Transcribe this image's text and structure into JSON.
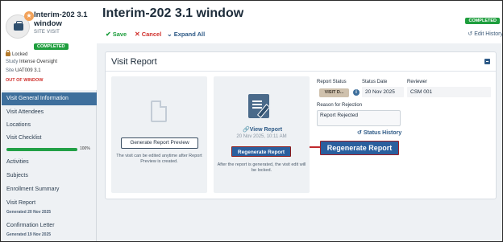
{
  "visit": {
    "title": "Interim-202 3.1 window",
    "type": "SITE VISIT",
    "status": "COMPLETED",
    "locked_label": "Locked",
    "study_label": "Study",
    "study": "Intense Oversight",
    "site_label": "Site",
    "site": "UAT009 3.1",
    "window_flag": "OUT OF WINDOW"
  },
  "nav": {
    "items": [
      {
        "label": "Visit General Information",
        "active": true
      },
      {
        "label": "Visit Attendees"
      },
      {
        "label": "Locations"
      },
      {
        "label": "Visit Checklist",
        "progress": 1.0,
        "progress_text": "100%"
      },
      {
        "label": "Activities"
      },
      {
        "label": "Subjects"
      },
      {
        "label": "Enrollment Summary"
      },
      {
        "label": "Visit Report",
        "sub": "Generated 20 Nov 2025"
      },
      {
        "label": "Confirmation Letter",
        "sub": "Generated 19 Nov 2025"
      }
    ]
  },
  "header": {
    "title": "Interim-202 3.1 window",
    "status": "COMPLETED"
  },
  "toolbar": {
    "save_label": "Save",
    "cancel_label": "Cancel",
    "expand_label": "Expand All",
    "history_label": "Edit History"
  },
  "report": {
    "section_title": "Visit Report",
    "generate_preview_label": "Generate Report Preview",
    "preview_note": "The visit can be edited anytime after Report Preview is created.",
    "view_link_label": "View Report",
    "view_date": "20 Nov 2025, 10:11 AM",
    "regenerate_label": "Regenerate Report",
    "regenerate_note": "After the report is generated, the visit edit will be locked.",
    "callout_label": "Regenerate Report",
    "fields": {
      "status_label": "Report Status",
      "status_value": "VISIT D...",
      "date_label": "Status Date",
      "date_value": "20 Nov 2025",
      "reviewer_label": "Reviewer",
      "reviewer_value": "CSM 001",
      "reason_label": "Reason for Rejection",
      "reason_value": "Report Rejected"
    },
    "status_history_label": "Status History"
  },
  "colors": {
    "accent": "#3e6f9c",
    "success": "#1e9e3d",
    "danger": "#d0312d",
    "button": "#2a5f9e"
  }
}
